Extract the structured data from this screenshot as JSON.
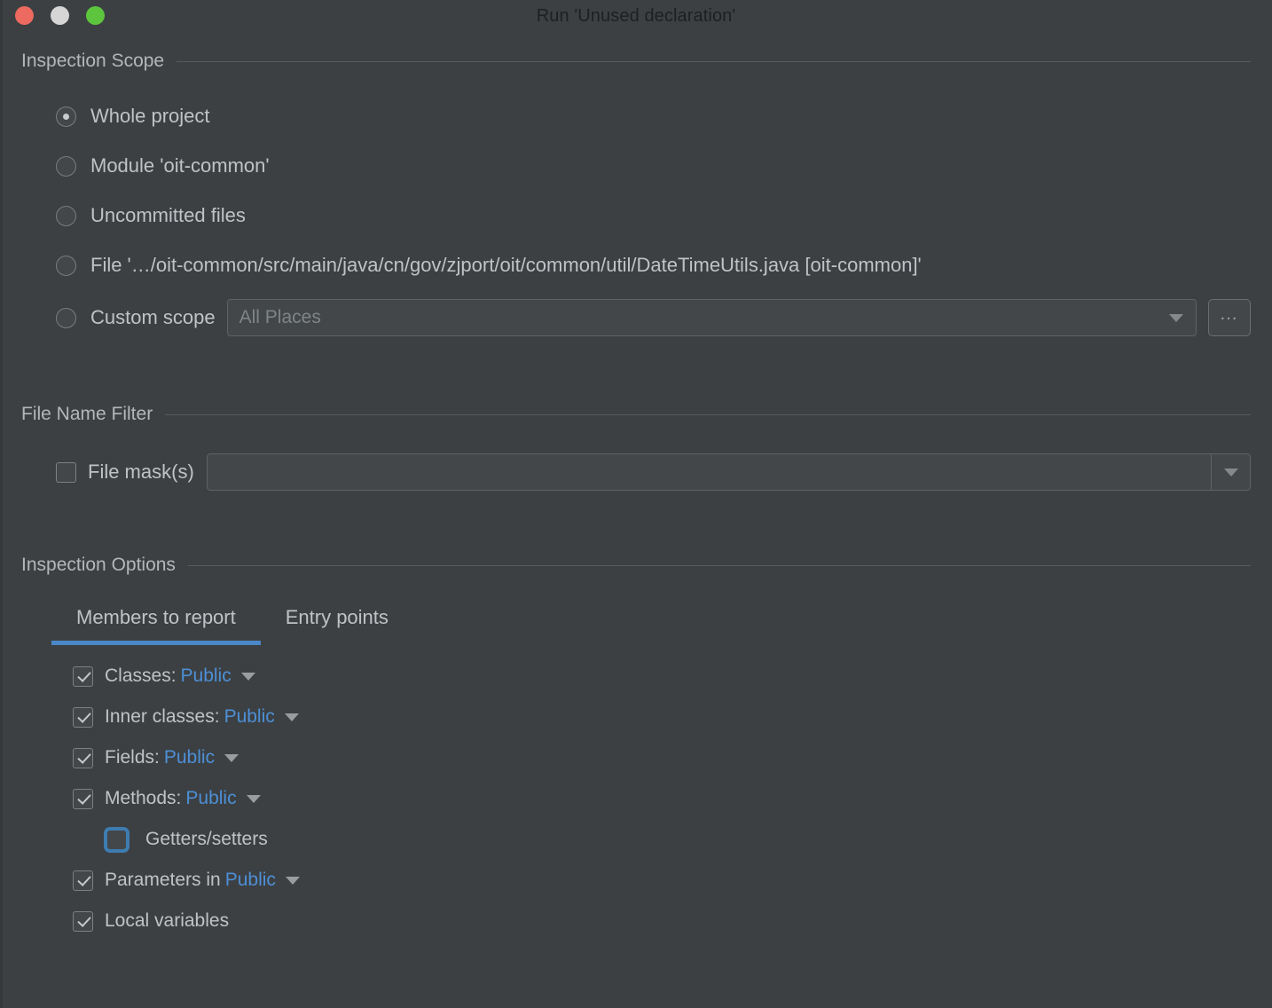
{
  "window": {
    "title": "Run 'Unused declaration'",
    "traffic_lights": [
      {
        "name": "close-button",
        "color": "#ec6a5f"
      },
      {
        "name": "minimize-button",
        "color": "#d6d6d6"
      },
      {
        "name": "zoom-button",
        "color": "#5dc53d"
      }
    ]
  },
  "inspection_scope": {
    "title": "Inspection Scope",
    "options": [
      {
        "label": "Whole project",
        "selected": true
      },
      {
        "label": "Module 'oit-common'",
        "selected": false
      },
      {
        "label": "Uncommitted files",
        "selected": false
      },
      {
        "label": "File '…/oit-common/src/main/java/cn/gov/zjport/oit/common/util/DateTimeUtils.java [oit-common]'",
        "selected": false
      }
    ],
    "custom_scope": {
      "label": "Custom scope",
      "selected": false,
      "combo_value": "All Places",
      "browse_label": "…"
    }
  },
  "file_name_filter": {
    "title": "File Name Filter",
    "file_mask": {
      "label": "File mask(s)",
      "checked": false,
      "value": "",
      "placeholder": ""
    }
  },
  "inspection_options": {
    "title": "Inspection Options",
    "tabs": [
      {
        "label": "Members to report",
        "active": true
      },
      {
        "label": "Entry points",
        "active": false
      }
    ],
    "members": [
      {
        "label": "Classes:",
        "value": "Public",
        "checked": true,
        "dropdown": true,
        "indent": false,
        "focused": false
      },
      {
        "label": "Inner classes:",
        "value": "Public",
        "checked": true,
        "dropdown": true,
        "indent": false,
        "focused": false
      },
      {
        "label": "Fields:",
        "value": "Public",
        "checked": true,
        "dropdown": true,
        "indent": false,
        "focused": false
      },
      {
        "label": "Methods:",
        "value": "Public",
        "checked": true,
        "dropdown": true,
        "indent": false,
        "focused": false
      },
      {
        "label": "Getters/setters",
        "value": "",
        "checked": false,
        "dropdown": false,
        "indent": true,
        "focused": true
      },
      {
        "label": "Parameters in",
        "value": "Public",
        "checked": true,
        "dropdown": true,
        "indent": false,
        "focused": false
      },
      {
        "label": "Local variables",
        "value": "",
        "checked": true,
        "dropdown": false,
        "indent": false,
        "focused": false
      }
    ]
  },
  "colors": {
    "background": "#3c4043",
    "accent_blue": "#4a88c7",
    "link_blue": "#4d8fd6",
    "text": "#c0c3c6"
  }
}
